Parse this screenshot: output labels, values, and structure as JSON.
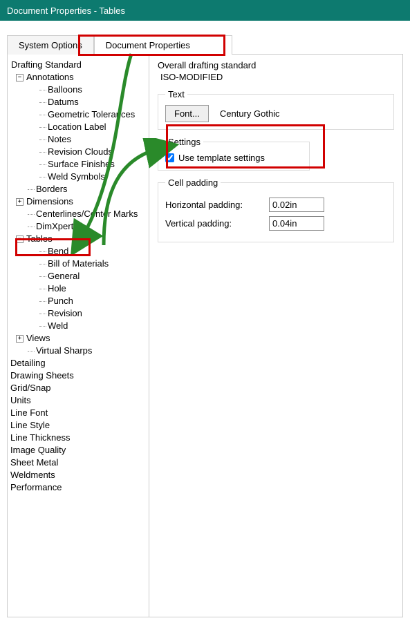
{
  "window": {
    "title": "Document Properties - Tables"
  },
  "tabs": {
    "system_options": "System Options",
    "document_properties": "Document Properties"
  },
  "tree": {
    "drafting_standard": "Drafting Standard",
    "annotations": "Annotations",
    "annotation_children": [
      "Balloons",
      "Datums",
      "Geometric Tolerances",
      "Location Label",
      "Notes",
      "Revision Clouds",
      "Surface Finishes",
      "Weld Symbols"
    ],
    "borders": "Borders",
    "dimensions": "Dimensions",
    "centerlines": "Centerlines/Center Marks",
    "dimxpert": "DimXpert",
    "tables": "Tables",
    "tables_children": [
      "Bend",
      "Bill of Materials",
      "General",
      "Hole",
      "Punch",
      "Revision",
      "Weld"
    ],
    "views": "Views",
    "virtual_sharps": "Virtual Sharps",
    "flat_items": [
      "Detailing",
      "Drawing Sheets",
      "Grid/Snap",
      "Units",
      "Line Font",
      "Line Style",
      "Line Thickness",
      "Image Quality",
      "Sheet Metal",
      "Weldments",
      "Performance"
    ]
  },
  "right": {
    "overall_label": "Overall drafting standard",
    "overall_value": "ISO-MODIFIED",
    "text_header": "Text",
    "font_button": "Font...",
    "font_value": "Century Gothic",
    "settings_header": "Settings",
    "use_template": "Use template settings",
    "cell_padding_header": "Cell padding",
    "hpad_label": "Horizontal padding:",
    "hpad_value": "0.02in",
    "vpad_label": "Vertical padding:",
    "vpad_value": "0.04in"
  }
}
